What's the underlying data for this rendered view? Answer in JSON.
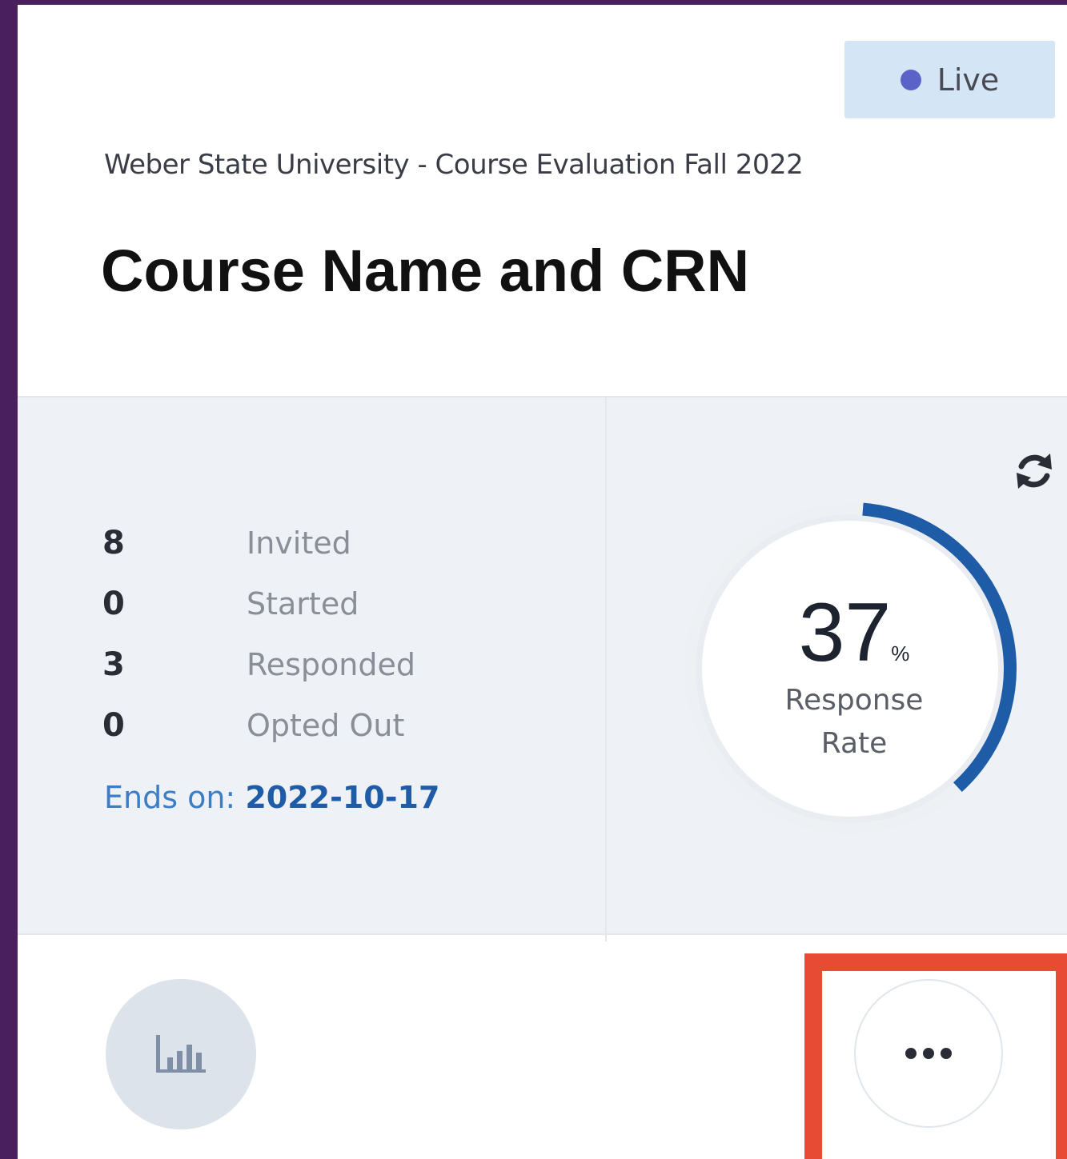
{
  "status": {
    "label": "Live",
    "dot_color": "#5b63c8"
  },
  "survey": {
    "name": "Weber State University - Course Evaluation Fall 2022",
    "course_title": "Course Name and CRN"
  },
  "stats": [
    {
      "value": "8",
      "label": "Invited"
    },
    {
      "value": "0",
      "label": "Started"
    },
    {
      "value": "3",
      "label": "Responded"
    },
    {
      "value": "0",
      "label": "Opted Out"
    }
  ],
  "ends": {
    "label": "Ends on:",
    "date": "2022-10-17"
  },
  "response_rate": {
    "value": "37",
    "unit": "%",
    "caption_line1": "Response",
    "caption_line2": "Rate",
    "fraction": 0.37,
    "arc_color": "#1f5ca8",
    "track_color": "#eef1f4"
  },
  "icons": {
    "refresh": "refresh-icon",
    "reports": "bar-chart-icon",
    "more": "more-horizontal-icon"
  },
  "colors": {
    "background": "#4a1f5e",
    "highlight": "#e84b33"
  }
}
